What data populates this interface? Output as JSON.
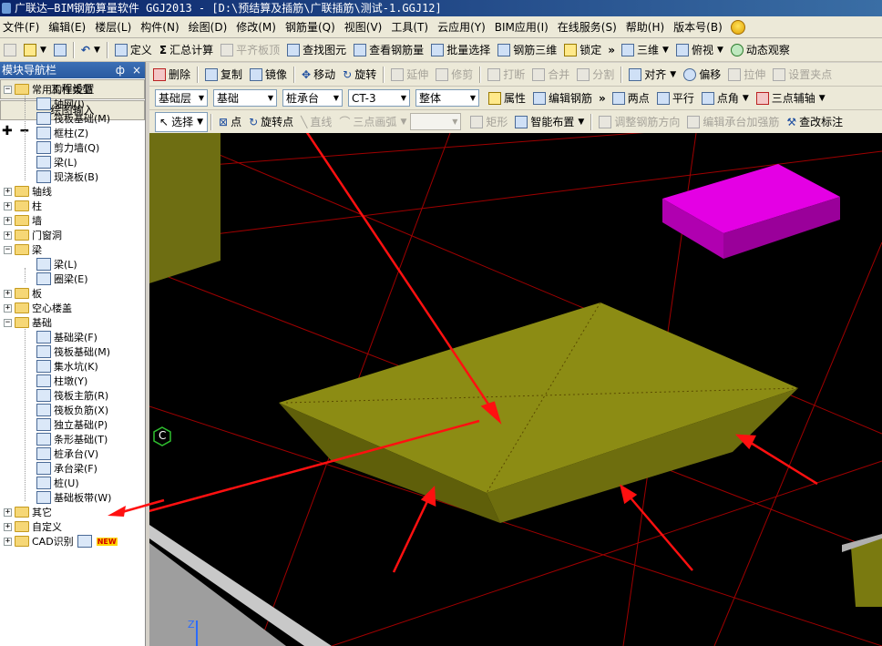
{
  "window": {
    "title": "广联达—BIM钢筋算量软件 GGJ2013 - [D:\\预结算及插筋\\广联插筋\\测试-1.GGJ12]"
  },
  "menu": [
    "文件(F)",
    "编辑(E)",
    "楼层(L)",
    "构件(N)",
    "绘图(D)",
    "修改(M)",
    "钢筋量(Q)",
    "视图(V)",
    "工具(T)",
    "云应用(Y)",
    "BIM应用(I)",
    "在线服务(S)",
    "帮助(H)",
    "版本号(B)"
  ],
  "toolbar1": {
    "define": "定义",
    "sum_calc": "汇总计算",
    "flat_slab_top": "平齐板顶",
    "find_element": "查找图元",
    "view_rebar_qty": "查看钢筋量",
    "batch_select": "批量选择",
    "rebar_3d": "钢筋三维",
    "lock": "锁定",
    "view_3d": "三维",
    "top_view": "俯视",
    "dynamic_view": "动态观察"
  },
  "panel": {
    "title": "模块导航栏",
    "pin": "ф",
    "close": "×",
    "project_settings": "工程设置",
    "drawing_input": "绘图输入"
  },
  "toolbar2": {
    "delete": "删除",
    "copy": "复制",
    "mirror": "镜像",
    "move": "移动",
    "rotate": "旋转",
    "extend": "延伸",
    "trim": "修剪",
    "break": "打断",
    "merge": "合并",
    "split": "分割",
    "align": "对齐",
    "offset": "偏移",
    "stretch": "拉伸",
    "set_grip": "设置夹点"
  },
  "toolbar3": {
    "floor": "基础层",
    "category": "基础",
    "element_type": "桩承台",
    "element_name": "CT-3",
    "unit": "整体",
    "properties": "属性",
    "edit_rebar": "编辑钢筋",
    "two_points": "两点",
    "parallel": "平行",
    "point_angle": "点角",
    "three_point_axis": "三点辅轴"
  },
  "toolbar4": {
    "select": "选择",
    "point": "点",
    "rotate_point": "旋转点",
    "line": "直线",
    "three_point_arc": "三点画弧",
    "rectangle": "矩形",
    "smart_layout": "智能布置",
    "adjust_rebar_dir": "调整钢筋方向",
    "edit_cap_rebar": "编辑承台加强筋",
    "modify_label": "查改标注"
  },
  "tree": {
    "common": "常用构件类型",
    "axis_grid": "轴网(J)",
    "raft": "筏板基础(M)",
    "frame_col": "框柱(Z)",
    "shear_wall": "剪力墙(Q)",
    "beam": "梁(L)",
    "cast_slab": "现浇板(B)",
    "axis": "轴线",
    "column": "柱",
    "wall": "墙",
    "door_window": "门窗洞",
    "beam_group": "梁",
    "beam_item": "梁(L)",
    "ring_beam": "圈梁(E)",
    "slab": "板",
    "hollow_floor": "空心楼盖",
    "foundation": "基础",
    "found_beam": "基础梁(F)",
    "raft2": "筏板基础(M)",
    "sump": "集水坑(K)",
    "pier": "柱墩(Y)",
    "raft_main_rebar": "筏板主筋(R)",
    "raft_neg_rebar": "筏板负筋(X)",
    "isolated_found": "独立基础(P)",
    "strip_found": "条形基础(T)",
    "pile_cap": "桩承台(V)",
    "cap_beam": "承台梁(F)",
    "pile": "桩(U)",
    "found_strip": "基础板带(W)",
    "others": "其它",
    "custom": "自定义",
    "cad": "CAD识别",
    "new_badge": "NEW"
  },
  "viewport": {
    "snap_label": "C",
    "axis_label": "Z",
    "pile_cap_color": "#7a7a10",
    "magenta_block": "#d400d4",
    "grid_color": "#b00000",
    "arrow_color": "#ff1010"
  }
}
